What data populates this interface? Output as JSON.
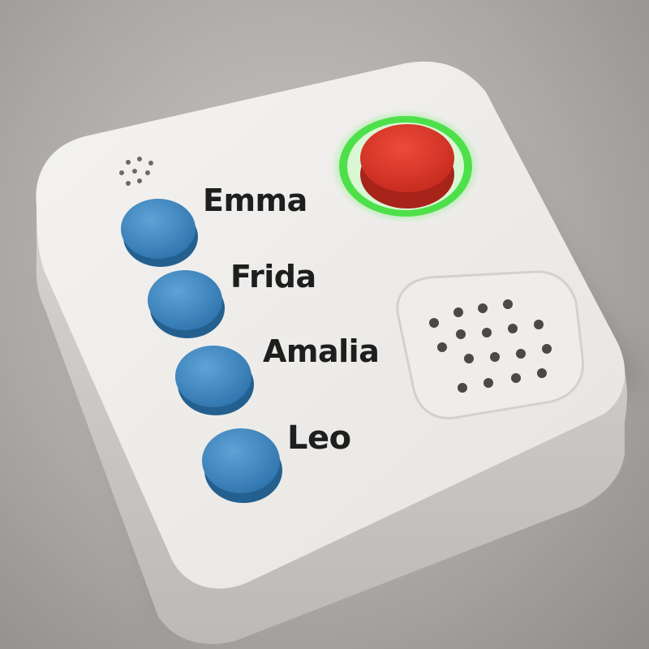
{
  "device": {
    "body_color": "#eceae7",
    "shadow_color": "#cfcdca",
    "buttons": [
      {
        "label": "Emma",
        "color": "#3f87c0"
      },
      {
        "label": "Frida",
        "color": "#3f87c0"
      },
      {
        "label": "Amalia",
        "color": "#3f87c0"
      },
      {
        "label": "Leo",
        "color": "#3f87c0"
      }
    ],
    "main_button": {
      "color": "#e0392a",
      "ring_color": "#3fd44a",
      "icon": "record-button"
    },
    "speaker_grille": {
      "icon": "speaker-grille"
    },
    "microphone": {
      "icon": "microphone-holes"
    }
  }
}
